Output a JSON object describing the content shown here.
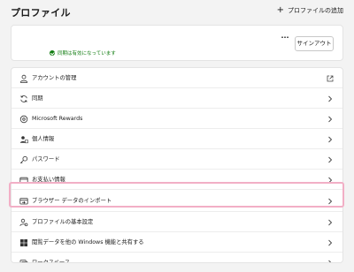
{
  "header": {
    "title": "プロファイル",
    "add_profile_label": "プロファイルの追加"
  },
  "profile": {
    "sync_status": "同期は有効になっています",
    "more_label": "···",
    "signout_label": "サインアウト"
  },
  "menu": {
    "items": [
      {
        "label": "アカウントの管理",
        "icon": "person-icon",
        "trailing": "external-link-icon"
      },
      {
        "label": "同期",
        "icon": "sync-icon",
        "trailing": "chevron-right-icon"
      },
      {
        "label": "Microsoft Rewards",
        "icon": "rewards-icon",
        "trailing": "chevron-right-icon"
      },
      {
        "label": "個人情報",
        "icon": "personal-info-icon",
        "trailing": "chevron-right-icon"
      },
      {
        "label": "パスワード",
        "icon": "key-icon",
        "trailing": "chevron-right-icon"
      },
      {
        "label": "お支払い情報",
        "icon": "credit-card-icon",
        "trailing": "chevron-right-icon"
      },
      {
        "label": "ブラウザー データのインポート",
        "icon": "import-icon",
        "trailing": "chevron-right-icon"
      },
      {
        "label": "プロファイルの基本設定",
        "icon": "profile-settings-icon",
        "trailing": "chevron-right-icon"
      },
      {
        "label": "閲覧データを他の Windows 機能と共有する",
        "icon": "windows-icon",
        "trailing": "chevron-right-icon"
      },
      {
        "label": "ワークスペース",
        "icon": "workspaces-icon",
        "trailing": "chevron-right-icon"
      }
    ]
  },
  "colors": {
    "highlight": "#f2afc6",
    "sync_green": "#107c10",
    "background": "#f3f3f3"
  }
}
